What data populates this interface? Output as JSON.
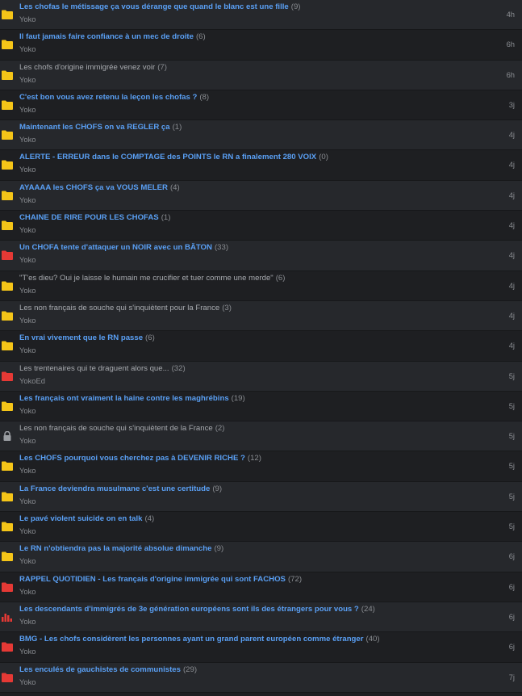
{
  "colors": {
    "link_unread": "#5aa0f5",
    "text_read": "#a8abb0",
    "muted": "#8a8d92",
    "folder_yellow": "#f5c518",
    "folder_red": "#e53935",
    "lock_grey": "#9a9da2"
  },
  "topics": [
    {
      "icon": "folder-yellow-icon",
      "title": "Les chofas le métissage ça vous dérange que quand le blanc est une fille",
      "count": "(9)",
      "author": "Yoko",
      "time": "4h",
      "read": false
    },
    {
      "icon": "folder-yellow-icon",
      "title": "Il faut jamais faire confiance à un mec de droite",
      "count": "(6)",
      "author": "Yoko",
      "time": "6h",
      "read": false
    },
    {
      "icon": "folder-yellow-icon",
      "title": "Les chofs d'origine immigrée venez voir",
      "count": "(7)",
      "author": "Yoko",
      "time": "6h",
      "read": true
    },
    {
      "icon": "folder-yellow-icon",
      "title": "C'est bon vous avez retenu la leçon les chofas ?",
      "count": "(8)",
      "author": "Yoko",
      "time": "3j",
      "read": false
    },
    {
      "icon": "folder-yellow-icon",
      "title": "Maintenant les CHOFS on va REGLER ça",
      "count": "(1)",
      "author": "Yoko",
      "time": "4j",
      "read": false
    },
    {
      "icon": "folder-yellow-icon",
      "title": "ALERTE - ERREUR dans le COMPTAGE des POINTS le RN a finalement 280 VOIX",
      "count": "(0)",
      "author": "Yoko",
      "time": "4j",
      "read": false
    },
    {
      "icon": "folder-yellow-icon",
      "title": "AYAAAA les CHOFS ça va VOUS MELER",
      "count": "(4)",
      "author": "Yoko",
      "time": "4j",
      "read": false
    },
    {
      "icon": "folder-yellow-icon",
      "title": "CHAINE DE RIRE POUR LES CHOFAS",
      "count": "(1)",
      "author": "Yoko",
      "time": "4j",
      "read": false
    },
    {
      "icon": "folder-red-icon",
      "title": "Un CHOFA tente d'attaquer un NOIR avec un BÂTON",
      "count": "(33)",
      "author": "Yoko",
      "time": "4j",
      "read": false
    },
    {
      "icon": "folder-yellow-icon",
      "title": "\"T'es dieu? Oui je laisse le humain me crucifier et tuer comme une merde\"",
      "count": "(6)",
      "author": "Yoko",
      "time": "4j",
      "read": true
    },
    {
      "icon": "folder-yellow-icon",
      "title": "Les non français de souche qui s'inquiètent pour la France",
      "count": "(3)",
      "author": "Yoko",
      "time": "4j",
      "read": true
    },
    {
      "icon": "folder-yellow-icon",
      "title": "En vrai vivement que le RN passe",
      "count": "(6)",
      "author": "Yoko",
      "time": "4j",
      "read": false
    },
    {
      "icon": "folder-red-icon",
      "title": "Les trentenaires qui te draguent alors que...",
      "count": "(32)",
      "author": "YokoEd",
      "time": "5j",
      "read": true
    },
    {
      "icon": "folder-yellow-icon",
      "title": "Les français ont vraiment la haine contre les maghrébins",
      "count": "(19)",
      "author": "Yoko",
      "time": "5j",
      "read": false
    },
    {
      "icon": "lock-icon",
      "title": "Les non français de souche qui s'inquiètent de la France",
      "count": "(2)",
      "author": "Yoko",
      "time": "5j",
      "read": true
    },
    {
      "icon": "folder-yellow-icon",
      "title": "Les CHOFS pourquoi vous cherchez pas à DEVENIR RICHE ?",
      "count": "(12)",
      "author": "Yoko",
      "time": "5j",
      "read": false
    },
    {
      "icon": "folder-yellow-icon",
      "title": "La France deviendra musulmane c'est une certitude",
      "count": "(9)",
      "author": "Yoko",
      "time": "5j",
      "read": false
    },
    {
      "icon": "folder-yellow-icon",
      "title": "Le pavé violent suicide on en talk",
      "count": "(4)",
      "author": "Yoko",
      "time": "5j",
      "read": false
    },
    {
      "icon": "folder-yellow-icon",
      "title": "Le RN n'obtiendra pas la majorité absolue dimanche",
      "count": "(9)",
      "author": "Yoko",
      "time": "6j",
      "read": false
    },
    {
      "icon": "folder-red-icon",
      "title": "RAPPEL QUOTIDIEN - Les français d'origine immigrée qui sont FACHOS",
      "count": "(72)",
      "author": "Yoko",
      "time": "6j",
      "read": false
    },
    {
      "icon": "poll-icon",
      "title": "Les descendants d'immigrés de 3e génération européens sont ils des étrangers pour vous ?",
      "count": "(24)",
      "author": "Yoko",
      "time": "6j",
      "read": false
    },
    {
      "icon": "folder-red-icon",
      "title": "BMG - Les chofs considèrent les personnes ayant un grand parent européen comme étranger",
      "count": "(40)",
      "author": "Yoko",
      "time": "6j",
      "read": false
    },
    {
      "icon": "folder-red-icon",
      "title": "Les enculés de gauchistes de communistes",
      "count": "(29)",
      "author": "Yoko",
      "time": "7j",
      "read": false
    }
  ]
}
